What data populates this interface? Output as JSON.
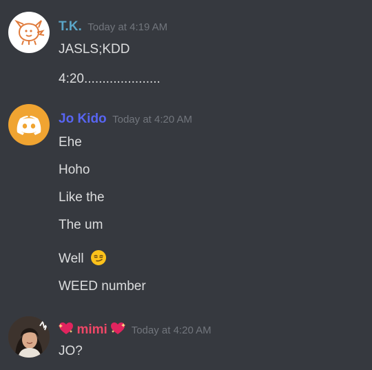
{
  "messages": [
    {
      "username": "T.K.",
      "username_color": "#5aa5c7",
      "timestamp": "Today at 4:19 AM",
      "avatar_icon": "pig-doodle-icon",
      "lines": [
        "JASLS;KDD",
        "4:20....................."
      ]
    },
    {
      "username": "Jo Kido",
      "username_color": "#5865f2",
      "timestamp": "Today at 4:20 AM",
      "avatar_icon": "discord-logo-icon",
      "lines": [
        "Ehe",
        "Hoho",
        "Like the",
        "The um",
        "Well",
        "WEED number"
      ],
      "emoji_after_line_5": "smirking-face-icon"
    },
    {
      "username": "mimi",
      "username_color": "#f04767",
      "timestamp": "Today at 4:20 AM",
      "avatar_icon": "user-photo-avatar",
      "username_decoration": "sparkling-heart-icon",
      "lines": [
        "JO?"
      ]
    }
  ]
}
